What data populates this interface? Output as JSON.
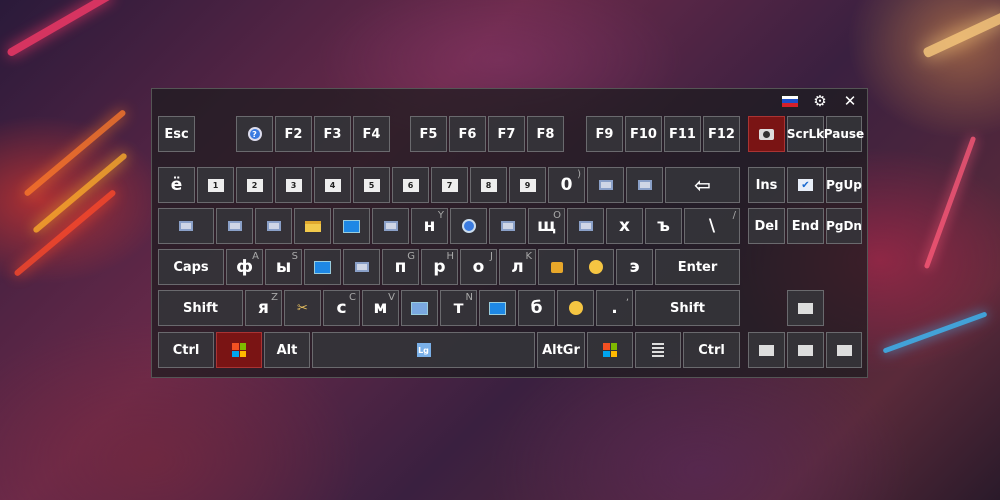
{
  "window": {
    "language_flag": "russian-flag",
    "settings_icon": "gear-icon",
    "close_label": "✕"
  },
  "keys": {
    "esc": "Esc",
    "f2": "F2",
    "f3": "F3",
    "f4": "F4",
    "f5": "F5",
    "f6": "F6",
    "f7": "F7",
    "f8": "F8",
    "f9": "F9",
    "f10": "F10",
    "f11": "F11",
    "f12": "F12",
    "scrlk": "ScrLk",
    "pause": "Pause",
    "yo": "ё",
    "k0": "0",
    "sub0": ")",
    "ins": "Ins",
    "pgup": "PgUp",
    "n": "н",
    "sub_n": "Y",
    "shch": "щ",
    "sub_shch": "O",
    "kh": "х",
    "hard": "ъ",
    "backslash": "\\",
    "sub_backslash": "/",
    "del": "Del",
    "end": "End",
    "pgdn": "PgDn",
    "caps": "Caps",
    "f_ru": "ф",
    "sub_f": "A",
    "y_ru": "ы",
    "sub_y": "S",
    "p_ru": "п",
    "r_ru": "р",
    "sub_r": "H",
    "sub_p": "G",
    "o_ru": "о",
    "sub_o": "J",
    "l_ru": "л",
    "sub_l": "K",
    "e_ru": "э",
    "enter": "Enter",
    "shift_l": "Shift",
    "ya": "я",
    "sub_ya": "Z",
    "s_ru": "с",
    "sub_s": "C",
    "m_ru": "м",
    "sub_m": "V",
    "t_ru": "т",
    "sub_t": "N",
    "b_ru": "б",
    "dot": ".",
    "sub_dot": ",",
    "shift_r": "Shift",
    "ctrl_l": "Ctrl",
    "alt": "Alt",
    "space_icon": "Lg",
    "altgr": "AltGr",
    "ctrl_r": "Ctrl",
    "num1": "1",
    "num2": "2",
    "num3": "3",
    "num4": "4",
    "num5": "5",
    "num6": "6",
    "num7": "7",
    "num8": "8",
    "num9": "9"
  }
}
